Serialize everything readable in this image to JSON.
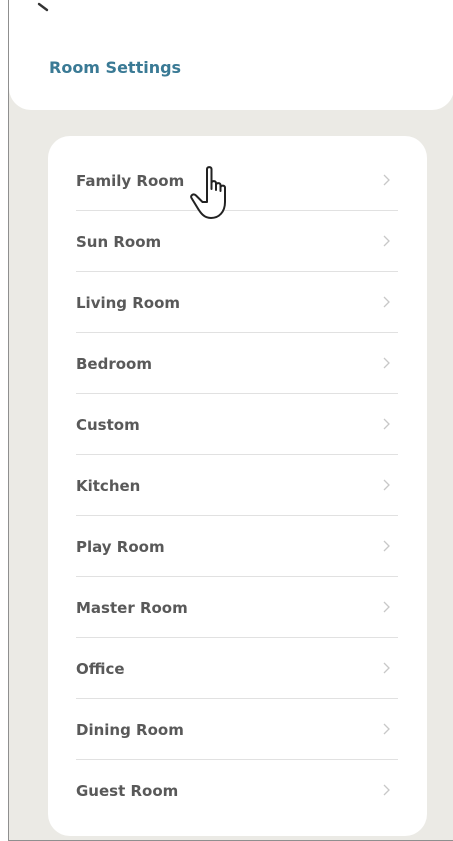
{
  "header": {
    "title": "Room Settings",
    "back_icon": "back-arrow-icon"
  },
  "rooms": [
    {
      "label": "Family Room"
    },
    {
      "label": "Sun Room"
    },
    {
      "label": "Living Room"
    },
    {
      "label": "Bedroom"
    },
    {
      "label": "Custom"
    },
    {
      "label": "Kitchen"
    },
    {
      "label": "Play Room"
    },
    {
      "label": "Master Room"
    },
    {
      "label": "Office"
    },
    {
      "label": "Dining Room"
    },
    {
      "label": "Guest Room"
    }
  ],
  "icons": {
    "row_chevron": "chevron-right-icon",
    "cursor": "hand-pointer-icon"
  },
  "colors": {
    "title": "#3a7a95",
    "label": "#595959",
    "background": "#ebeae5",
    "card": "#ffffff",
    "chevron": "#c8c8c8"
  }
}
